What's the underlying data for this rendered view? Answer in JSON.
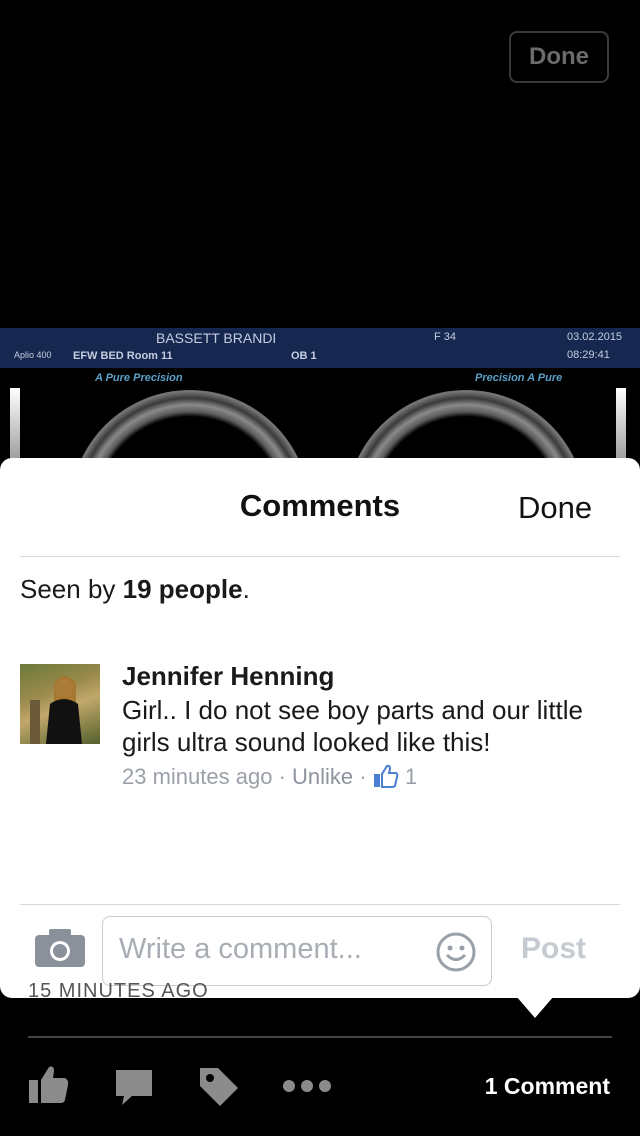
{
  "top": {
    "done_label": "Done"
  },
  "ultrasound": {
    "patient": "BASSETT BRANDI",
    "f_value": "F 34",
    "date": "03.02.2015",
    "time": "08:29:41",
    "machine": "Aplio 400",
    "room": "EFW BED Room 11",
    "mode": "OB 1",
    "left_tag": "A Pure Precision",
    "right_tag": "Precision  A Pure"
  },
  "comments_panel": {
    "title": "Comments",
    "done_label": "Done",
    "seen_prefix": "Seen by ",
    "seen_count": "19 people",
    "seen_suffix": ".",
    "comment": {
      "author": "Jennifer Henning",
      "text": "Girl.. I do not see boy parts and our little girls ultra sound looked like this!",
      "time": "23 minutes ago",
      "sep": "·",
      "unlike_label": "Unlike",
      "like_count": "1"
    },
    "composer": {
      "placeholder": "Write a comment...",
      "post_label": "Post"
    }
  },
  "bottom_bar": {
    "ghost_text": "15 MINUTES AGO",
    "comment_count": "1 Comment"
  },
  "icons": [
    "like-icon",
    "comment-icon",
    "tag-icon",
    "more-icon",
    "camera-icon",
    "emoji-icon",
    "thumbs-up-icon"
  ],
  "colors": {
    "accent_blue": "#4a7fd1",
    "card_bg": "#ffffff",
    "background": "#000000"
  }
}
